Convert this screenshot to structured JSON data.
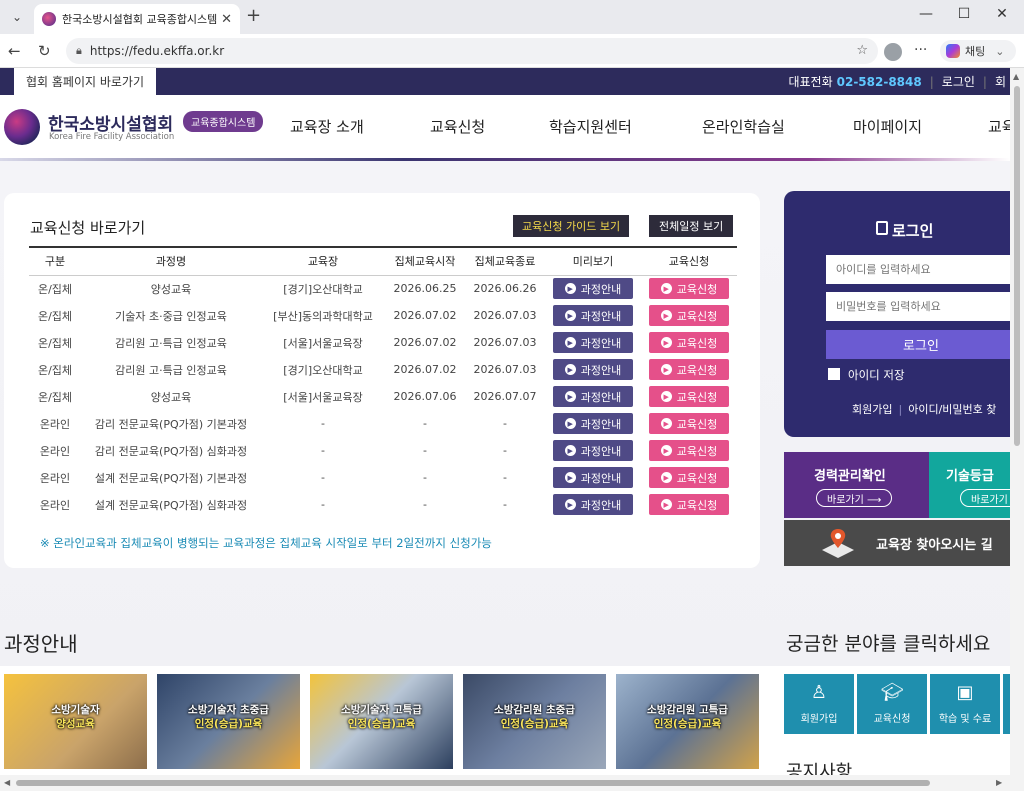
{
  "browser": {
    "tab_title": "한국소방시설협회 교육종합시스템",
    "url": "https://fedu.ekffa.or.kr",
    "copilot_label": "채팅"
  },
  "topbar": {
    "home_link": "협회 홈페이지 바로가기",
    "phone_label": "대표전화",
    "phone_number": "02-582-8848",
    "login_link": "로그인",
    "signup_link_partial": "회"
  },
  "logo": {
    "name": "한국소방시설협회",
    "english": "Korea Fire Facility Association",
    "badge": "교육종합시스템"
  },
  "gnb": [
    "교육장 소개",
    "교육신청",
    "학습지원센터",
    "온라인학습실",
    "마이페이지",
    "교육"
  ],
  "apply": {
    "title": "교육신청 바로가기",
    "guide_button": "교육신청 가이드 보기",
    "schedule_button": "전체일정 보기",
    "columns": [
      "구분",
      "과정명",
      "교육장",
      "집체교육시작",
      "집체교육종료",
      "미리보기",
      "교육신청"
    ],
    "info_label": "과정안내",
    "apply_label": "교육신청",
    "rows": [
      {
        "type": "온/집체",
        "course": "양성교육",
        "place": "[경기]오산대학교",
        "start": "2026.06.25",
        "end": "2026.06.26"
      },
      {
        "type": "온/집체",
        "course": "기술자 초·중급 인정교육",
        "place": "[부산]동의과학대학교",
        "start": "2026.07.02",
        "end": "2026.07.03"
      },
      {
        "type": "온/집체",
        "course": "감리원 고·특급 인정교육",
        "place": "[서울]서울교육장",
        "start": "2026.07.02",
        "end": "2026.07.03"
      },
      {
        "type": "온/집체",
        "course": "감리원 고·특급 인정교육",
        "place": "[경기]오산대학교",
        "start": "2026.07.02",
        "end": "2026.07.03"
      },
      {
        "type": "온/집체",
        "course": "양성교육",
        "place": "[서울]서울교육장",
        "start": "2026.07.06",
        "end": "2026.07.07"
      },
      {
        "type": "온라인",
        "course": "감리 전문교육(PQ가점) 기본과정",
        "place": "-",
        "start": "-",
        "end": "-"
      },
      {
        "type": "온라인",
        "course": "감리 전문교육(PQ가점) 심화과정",
        "place": "-",
        "start": "-",
        "end": "-"
      },
      {
        "type": "온라인",
        "course": "설계 전문교육(PQ가점) 기본과정",
        "place": "-",
        "start": "-",
        "end": "-"
      },
      {
        "type": "온라인",
        "course": "설계 전문교육(PQ가점) 심화과정",
        "place": "-",
        "start": "-",
        "end": "-"
      }
    ],
    "notice": "※ 온라인교육과 집체교육이 병행되는 교육과정은 집체교육 시작일로 부터 2일전까지 신청가능"
  },
  "login": {
    "title": "로그인",
    "id_placeholder": "아이디를 입력하세요",
    "pw_placeholder": "비밀번호를 입력하세요",
    "button": "로그인",
    "remember": "아이디 저장",
    "signup": "회원가입",
    "find": "아이디/비밀번호 찾"
  },
  "quick": {
    "career_title": "경력관리확인",
    "career_button": "바로가기 ⟶",
    "skill_title": "기술등급 ",
    "skill_button": "바로가기",
    "place_text": "교육장 찾아오시는 길"
  },
  "courses": {
    "title": "과정안내",
    "items": [
      {
        "line1": "소방기술자",
        "line2": "양성교육"
      },
      {
        "line1": "소방기술자 초중급",
        "line2": "인정(승급)교육"
      },
      {
        "line1": "소방기술자 고특급",
        "line2": "인정(승급)교육"
      },
      {
        "line1": "소방감리원 초중급",
        "line2": "인정(승급)교육"
      },
      {
        "line1": "소방감리원 고특급",
        "line2": "인정(승급)교육"
      }
    ]
  },
  "fields": {
    "title": "궁금한 분야를 클릭하세요",
    "items": [
      "회원가입",
      "교육신청",
      "학습 및 수료"
    ]
  },
  "notice_board": {
    "title": "공지사항"
  }
}
